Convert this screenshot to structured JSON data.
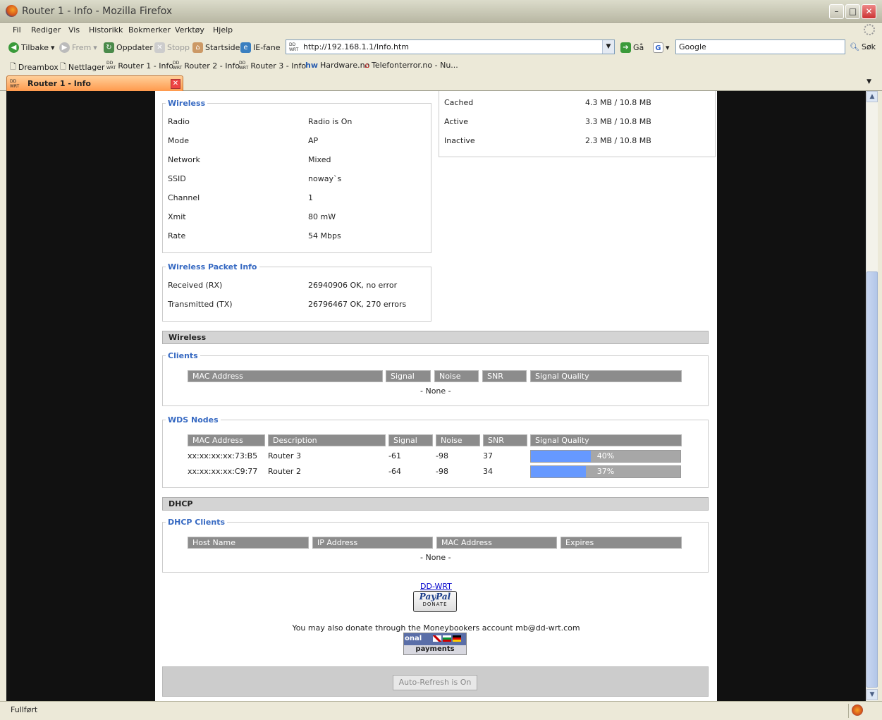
{
  "window": {
    "title": "Router 1 - Info - Mozilla Firefox"
  },
  "menu": [
    "Fil",
    "Rediger",
    "Vis",
    "Historikk",
    "Bokmerker",
    "Verktøy",
    "Hjelp"
  ],
  "nav": {
    "back": "Tilbake",
    "forward": "Frem",
    "reload": "Oppdater",
    "stop": "Stopp",
    "home": "Startside",
    "ie_tab": "IE-fane",
    "url": "http://192.168.1.1/Info.htm",
    "go": "Gå",
    "search_value": "Google",
    "search_btn": "Søk"
  },
  "bookmarks": [
    "Dreambox",
    "Nettlager",
    "Router 1 - Info",
    "Router 2 - Info",
    "Router 3 - Info",
    "Hardware.no",
    "Telefonterror.no - Nu..."
  ],
  "tab": {
    "label": "Router 1 - Info"
  },
  "memory": {
    "rows": [
      {
        "label": "Cached",
        "value": "4.3 MB / 10.8 MB"
      },
      {
        "label": "Active",
        "value": "3.3 MB / 10.8 MB"
      },
      {
        "label": "Inactive",
        "value": "2.3 MB / 10.8 MB"
      }
    ]
  },
  "wireless_info": {
    "legend": "Wireless",
    "rows": [
      {
        "label": "Radio",
        "value": "Radio is On"
      },
      {
        "label": "Mode",
        "value": "AP"
      },
      {
        "label": "Network",
        "value": "Mixed"
      },
      {
        "label": "SSID",
        "value": "noway`s"
      },
      {
        "label": "Channel",
        "value": "1"
      },
      {
        "label": "Xmit",
        "value": "80 mW"
      },
      {
        "label": "Rate",
        "value": "54 Mbps"
      }
    ]
  },
  "packet_info": {
    "legend": "Wireless Packet Info",
    "rows": [
      {
        "label": "Received (RX)",
        "value": "26940906 OK, no error"
      },
      {
        "label": "Transmitted (TX)",
        "value": "26796467 OK, 270 errors"
      }
    ]
  },
  "wireless_section": {
    "title": "Wireless",
    "clients": {
      "legend": "Clients",
      "headers": [
        "MAC Address",
        "Signal",
        "Noise",
        "SNR",
        "Signal Quality"
      ],
      "empty": "- None -"
    },
    "wds": {
      "legend": "WDS Nodes",
      "headers": [
        "MAC Address",
        "Description",
        "Signal",
        "Noise",
        "SNR",
        "Signal Quality"
      ],
      "rows": [
        {
          "mac": "xx:xx:xx:xx:73:B5",
          "desc": "Router 3",
          "signal": "-61",
          "noise": "-98",
          "snr": "37",
          "quality": "40%",
          "quality_value": 40
        },
        {
          "mac": "xx:xx:xx:xx:C9:77",
          "desc": "Router 2",
          "signal": "-64",
          "noise": "-98",
          "snr": "34",
          "quality": "37%",
          "quality_value": 37
        }
      ]
    }
  },
  "dhcp_section": {
    "title": "DHCP",
    "clients": {
      "legend": "DHCP Clients",
      "headers": [
        "Host Name",
        "IP Address",
        "MAC Address",
        "Expires"
      ],
      "empty": "- None -"
    }
  },
  "footer": {
    "ddwrt_link": "DD-WRT",
    "paypal_logo": "PayPal",
    "paypal_donate": "DONATE",
    "moneybookers_text": "You may also donate through the Moneybookers account mb@dd-wrt.com",
    "mb_top": "onal",
    "mb_bottom": "payments",
    "refresh_button": "Auto-Refresh is On"
  },
  "status": {
    "text": "Fullført"
  },
  "colors": {
    "quality_fill": "#6699ff",
    "legend": "#3669c2",
    "tab_active": "#ff9a4d"
  }
}
